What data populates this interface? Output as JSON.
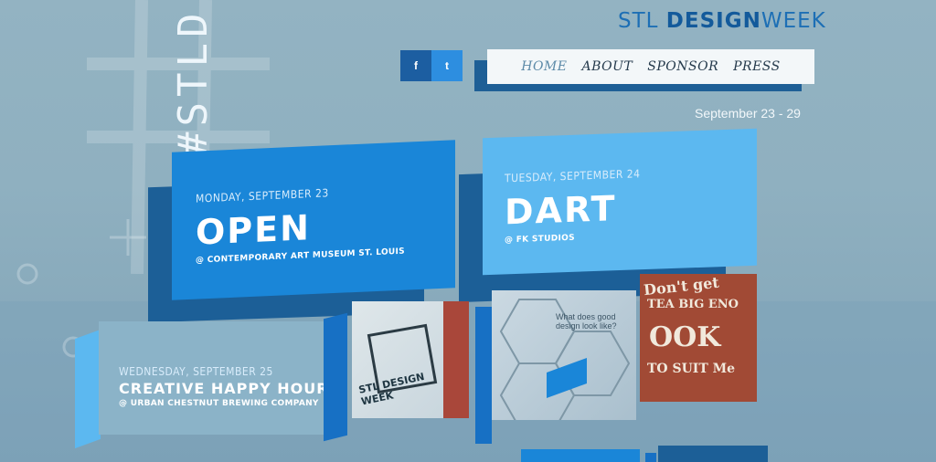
{
  "header": {
    "brand_light_1": "STL ",
    "brand_bold": "DESIGN",
    "brand_light_2": "WEEK",
    "vertical_tag": "#STLD"
  },
  "social": [
    {
      "label": "f",
      "icon": "facebook-icon"
    },
    {
      "label": "t",
      "icon": "twitter-icon"
    }
  ],
  "nav": {
    "items": [
      "HOME",
      "ABOUT",
      "SPONSOR",
      "PRESS"
    ],
    "active": "HOME"
  },
  "dates": "September 23 - 29",
  "events": [
    {
      "day": "MONDAY, SEPTEMBER 23",
      "title": "OPEN",
      "venue": "@ CONTEMPORARY ART MUSEUM ST. LOUIS"
    },
    {
      "day": "TUESDAY, SEPTEMBER 24",
      "title": "DART",
      "venue": "@ FK STUDIOS"
    },
    {
      "day": "WEDNESDAY, SEPTEMBER 25",
      "title": "CREATIVE HAPPY HOUR",
      "venue": "@ URBAN CHESTNUT BREWING COMPANY"
    }
  ],
  "tiles": {
    "t1_text": "STL DESIGN WEEK",
    "t2_text": "What does good design look like?",
    "t3_words": [
      "Don't get",
      "TEA BIG ENO",
      "OOK",
      "TO SUIT Me"
    ]
  },
  "colors": {
    "primary": "#1a86d8",
    "light": "#5cb8f0",
    "dark": "#1c5f97",
    "background": "#8fb0c0"
  }
}
